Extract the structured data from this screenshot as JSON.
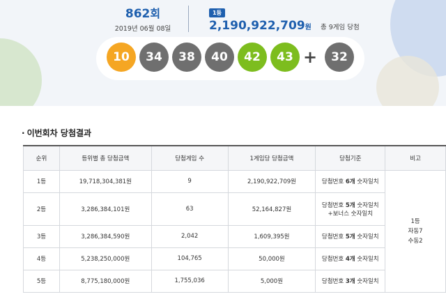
{
  "round": {
    "number": "862",
    "suffix": "회",
    "date": "2019년 06월 08일"
  },
  "first_prize": {
    "badge": "1등",
    "amount": "2,190,922,709",
    "unit": "원",
    "winners": "총 9게임 당첨"
  },
  "balls": {
    "main": [
      {
        "value": "10",
        "color": "#f5a623"
      },
      {
        "value": "34",
        "color": "#6f6f6f"
      },
      {
        "value": "38",
        "color": "#6f6f6f"
      },
      {
        "value": "40",
        "color": "#6f6f6f"
      },
      {
        "value": "42",
        "color": "#7dbd1e"
      },
      {
        "value": "43",
        "color": "#7dbd1e"
      }
    ],
    "plus": "+",
    "bonus": {
      "value": "32",
      "color": "#6f6f6f"
    }
  },
  "section": {
    "title": "이번회차 당첨결과"
  },
  "table": {
    "headers": [
      "순위",
      "등위별 총 당첨금액",
      "당첨게임 수",
      "1게임당 당첨금액",
      "당첨기준",
      "비고"
    ],
    "rows": [
      {
        "rank": "1등",
        "total": "19,718,304,381원",
        "games": "9",
        "per_game": "2,190,922,709원",
        "crit_pre": "당첨번호 ",
        "crit_bold": "6개",
        "crit_post": " 숫자일치",
        "crit2": ""
      },
      {
        "rank": "2등",
        "total": "3,286,384,101원",
        "games": "63",
        "per_game": "52,164,827원",
        "crit_pre": "당첨번호 ",
        "crit_bold": "5개",
        "crit_post": " 숫자일치",
        "crit2": "+보너스 숫자일치"
      },
      {
        "rank": "3등",
        "total": "3,286,384,590원",
        "games": "2,042",
        "per_game": "1,609,395원",
        "crit_pre": "당첨번호 ",
        "crit_bold": "5개",
        "crit_post": " 숫자일치",
        "crit2": ""
      },
      {
        "rank": "4등",
        "total": "5,238,250,000원",
        "games": "104,765",
        "per_game": "50,000원",
        "crit_pre": "당첨번호 ",
        "crit_bold": "4개",
        "crit_post": " 숫자일치",
        "crit2": ""
      },
      {
        "rank": "5등",
        "total": "8,775,180,000원",
        "games": "1,755,036",
        "per_game": "5,000원",
        "crit_pre": "당첨번호 ",
        "crit_bold": "3개",
        "crit_post": " 숫자일치",
        "crit2": ""
      }
    ],
    "note_lines": [
      "1등",
      "자동7",
      "수동2"
    ]
  }
}
